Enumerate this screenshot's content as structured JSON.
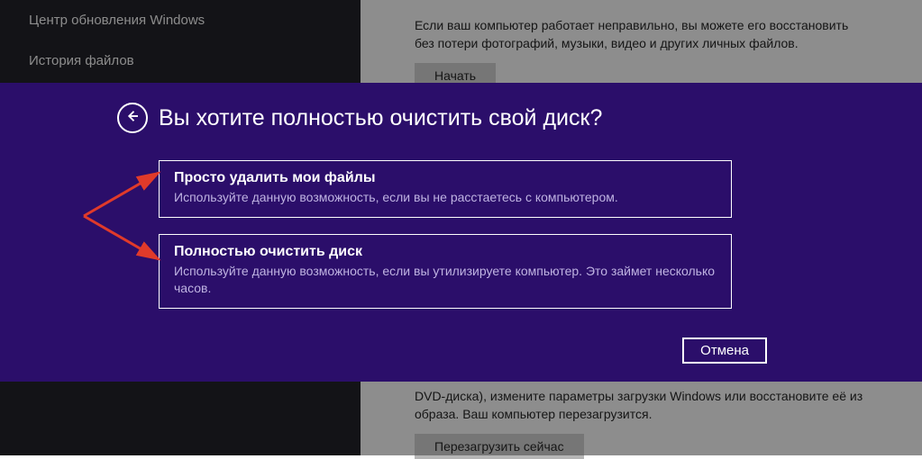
{
  "sidebar": {
    "items": [
      {
        "label": "Центр обновления Windows"
      },
      {
        "label": "История файлов"
      }
    ]
  },
  "right_panel": {
    "top_text": "Если ваш компьютер работает неправильно, вы можете его восстановить без потери фотографий, музыки, видео и других личных файлов.",
    "top_button": "Начать",
    "bottom_text_fragment": "DVD-диска), измените параметры загрузки Windows или восстановите её из образа. Ваш компьютер перезагрузится.",
    "bottom_button": "Перезагрузить сейчас"
  },
  "dialog": {
    "title": "Вы хотите полностью очистить свой диск?",
    "options": [
      {
        "title": "Просто удалить мои файлы",
        "desc": "Используйте данную возможность, если вы не расстаетесь с компьютером."
      },
      {
        "title": "Полностью очистить диск",
        "desc": "Используйте данную возможность, если вы утилизируете компьютер. Это займет несколько часов."
      }
    ],
    "cancel": "Отмена"
  }
}
